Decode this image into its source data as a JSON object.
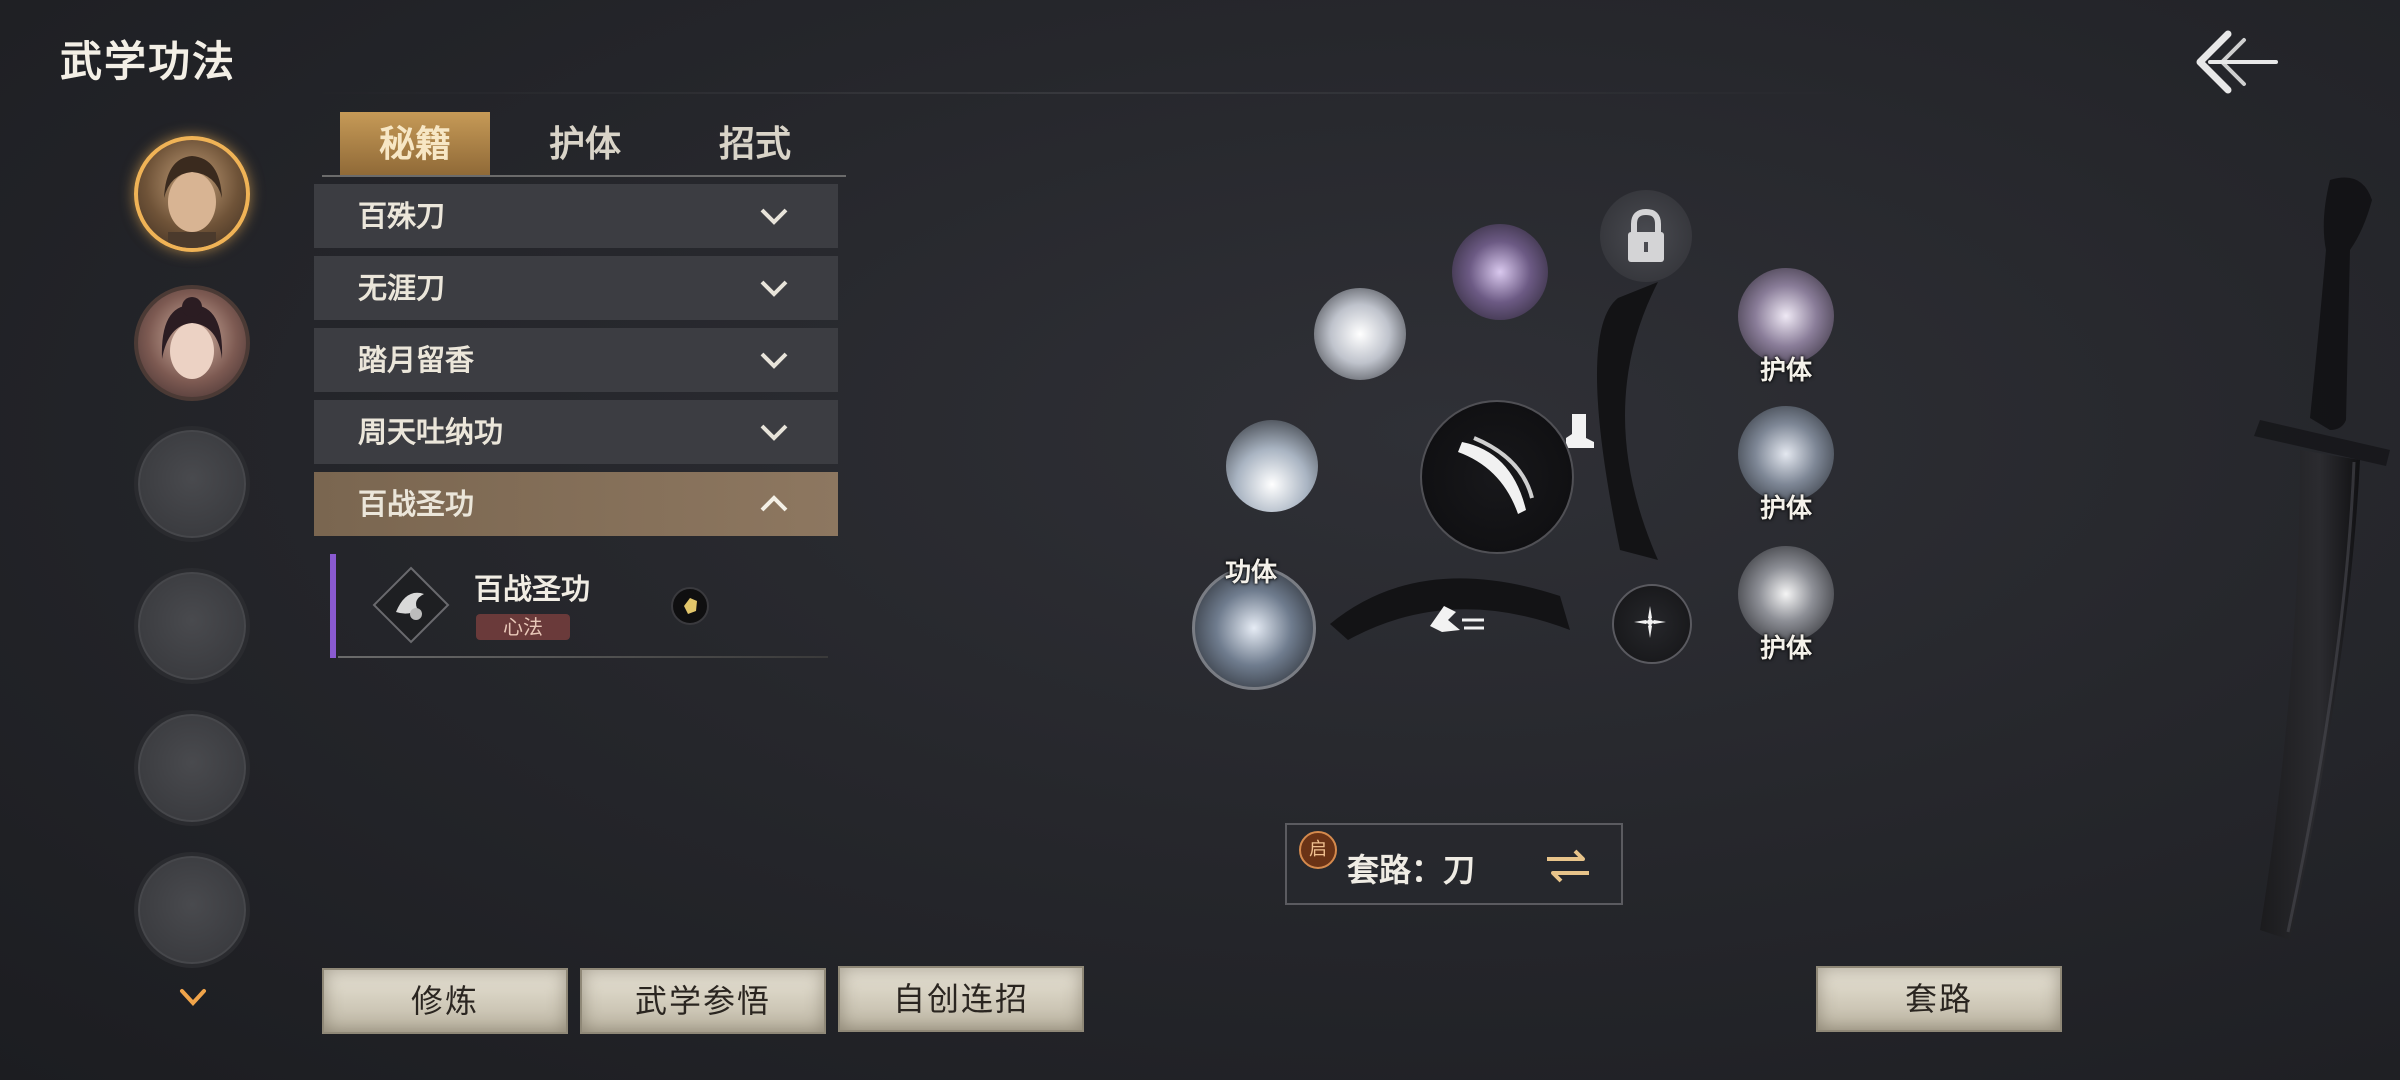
{
  "header": {
    "title": "武学功法"
  },
  "tabs": [
    {
      "label": "秘籍",
      "active": true
    },
    {
      "label": "护体",
      "active": false
    },
    {
      "label": "招式",
      "active": false
    }
  ],
  "categories": [
    {
      "label": "百殊刀",
      "expanded": false
    },
    {
      "label": "无涯刀",
      "expanded": false
    },
    {
      "label": "踏月留香",
      "expanded": false
    },
    {
      "label": "周天吐纳功",
      "expanded": false
    },
    {
      "label": "百战圣功",
      "expanded": true
    }
  ],
  "sub_item": {
    "name": "百战圣功",
    "tag": "心法"
  },
  "wheel": {
    "labels": {
      "gongti": "功体",
      "huti1": "护体",
      "huti2": "护体",
      "huti3": "护体"
    }
  },
  "route": {
    "badge": "启",
    "text": "套路：刀"
  },
  "buttons": {
    "practice": "修炼",
    "insight": "武学参悟",
    "combo": "自创连招",
    "route": "套路"
  },
  "colors": {
    "accent_gold": "#f0b356",
    "tab_active": "#b88a4c",
    "expanded_row": "#86715a",
    "sub_bar": "#8a5ad0"
  },
  "icons": [
    "back-arrow-icon",
    "chevron-down-icon",
    "chevron-up-icon",
    "lock-icon",
    "swap-icon",
    "scroll-down-icon"
  ]
}
